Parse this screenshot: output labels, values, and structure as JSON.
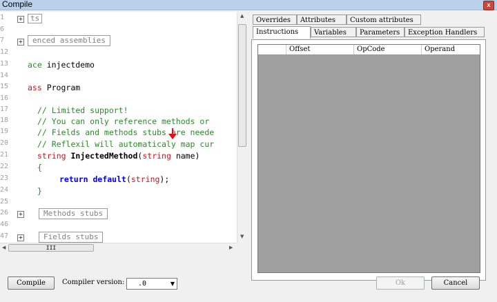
{
  "window": {
    "title": "Compile",
    "close_glyph": "x"
  },
  "editor": {
    "lines": [
      {
        "no": "1",
        "text": "ts"
      },
      {
        "no": "6",
        "text": ""
      },
      {
        "no": "7",
        "text": "enced assemblies"
      },
      {
        "no": "12",
        "text": ""
      },
      {
        "no": "13",
        "pre": "ace",
        "post": " injectdemo"
      },
      {
        "no": "14",
        "text": ""
      },
      {
        "no": "15",
        "pre": "ass",
        "post": " Program"
      },
      {
        "no": "16",
        "text": ""
      },
      {
        "no": "17",
        "text": "// Limited support!"
      },
      {
        "no": "18",
        "text": "// You can only reference methods or"
      },
      {
        "no": "19",
        "text": "// Fields and methods stubs are neede"
      },
      {
        "no": "20",
        "text": "// Reflexil will automaticaly map cur"
      },
      {
        "no": "21",
        "kw1": "string",
        "name": " InjectedMethod",
        "lp": "(",
        "kw2": "string",
        "rest": " name)"
      },
      {
        "no": "22",
        "text": "{"
      },
      {
        "no": "23",
        "ret": "return",
        "def": " default",
        "lp": "(",
        "kw": "string",
        "rp": ");"
      },
      {
        "no": "24",
        "text": "}"
      },
      {
        "no": "25",
        "text": ""
      },
      {
        "no": "26",
        "text": "Methods stubs"
      },
      {
        "no": "46",
        "text": ""
      },
      {
        "no": "47",
        "text": "Fields stubs"
      }
    ],
    "hscroll_thumb": "III"
  },
  "tabs": {
    "row1": [
      "Overrides",
      "Attributes",
      "Custom attributes"
    ],
    "row2": [
      "Instructions",
      "Variables",
      "Parameters",
      "Exception Handlers"
    ],
    "active": "Instructions"
  },
  "grid": {
    "columns": [
      "Offset",
      "OpCode",
      "Operand"
    ]
  },
  "footer": {
    "compile_label": "Compile",
    "compiler_version_label": "Compiler version:",
    "compiler_version_value": ".0",
    "ok_label": "Ok",
    "cancel_label": "Cancel"
  }
}
